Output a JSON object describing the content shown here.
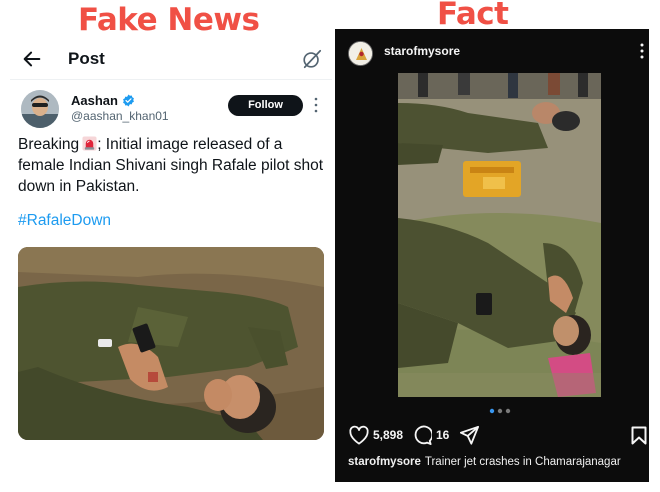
{
  "labels": {
    "fake": "Fake News",
    "fact": "Fact"
  },
  "xpost": {
    "header_title": "Post",
    "author": {
      "name": "Aashan",
      "handle": "@aashan_khan01",
      "verified": true
    },
    "follow_label": "Follow",
    "text_before_emoji": "Breaking",
    "emoji_icon": "siren-emoji",
    "text_after_emoji": "; Initial image released of a female Indian Shivani singh Rafale pilot shot down in Pakistan.",
    "hashtag": "#RafaleDown",
    "media_alt": "Photo of a person in a flight suit lying on the ground",
    "colors": {
      "link": "#1d9bf0",
      "verified": "#1d9bf0",
      "follow_bg": "#0f1419"
    }
  },
  "igpost": {
    "username": "starofmysore",
    "likes": "5,898",
    "comments": "16",
    "caption_user": "starofmysore",
    "caption_text": "Trainer jet crashes in Chamarajanagar",
    "carousel_dots": 3,
    "carousel_active": 1,
    "media_alt": "Two pilots in flight suits lying on the ground next to an orange parachute pack",
    "colors": {
      "background": "#0c0c0c",
      "text": "#f5f5f5"
    }
  },
  "banner_color": "#f05045"
}
